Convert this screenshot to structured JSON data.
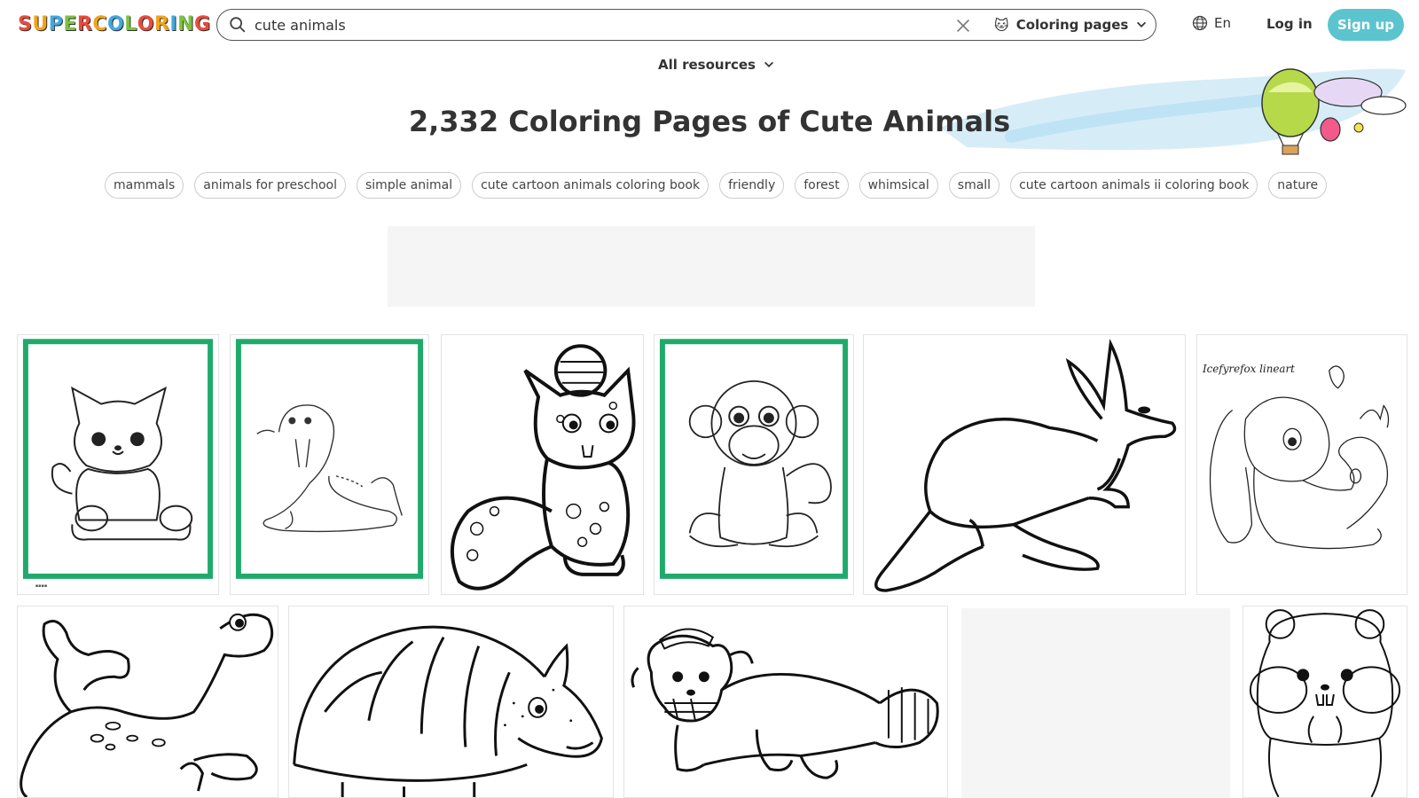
{
  "header": {
    "logo_letters": [
      "S",
      "U",
      "P",
      "E",
      "R",
      "C",
      "O",
      "L",
      "O",
      "R",
      "I",
      "N",
      "G"
    ],
    "logo_colors": [
      "#e84b3c",
      "#f2a31b",
      "#3fa9e0",
      "#7cc242",
      "#e84b3c",
      "#f2a31b",
      "#3fa9e0",
      "#7cc242",
      "#e84b3c",
      "#f2a31b",
      "#3fa9e0",
      "#7cc242",
      "#e84b3c"
    ],
    "search_value": "cute animals",
    "type_emoji": "🐱",
    "type_label": "Coloring pages",
    "lang_label": "En",
    "login_label": "Log in",
    "signup_label": "Sign up"
  },
  "filters": {
    "all_resources_label": "All resources"
  },
  "page": {
    "title": "2,332 Coloring Pages of Cute Animals"
  },
  "tags": [
    "mammals",
    "animals for preschool",
    "simple animal",
    "cute cartoon animals coloring book",
    "friendly",
    "forest",
    "whimsical",
    "small",
    "cute cartoon animals ii coloring book",
    "nature"
  ],
  "cards": [
    {
      "subject": "kitten"
    },
    {
      "subject": "walrus"
    },
    {
      "subject": "leopard cub"
    },
    {
      "subject": "monkey"
    },
    {
      "subject": "kangaroo"
    },
    {
      "subject": "bunny"
    },
    {
      "subject": "sea lion"
    },
    {
      "subject": "armadillo"
    },
    {
      "subject": "red panda"
    },
    {
      "subject": "loading"
    },
    {
      "subject": "hamster"
    }
  ],
  "card_texts": {
    "bunny_signature": "Icefyrefox lineart"
  },
  "colors": {
    "accent": "#5bc4cf",
    "frame_green": "#1faa6b",
    "text": "#333333"
  }
}
